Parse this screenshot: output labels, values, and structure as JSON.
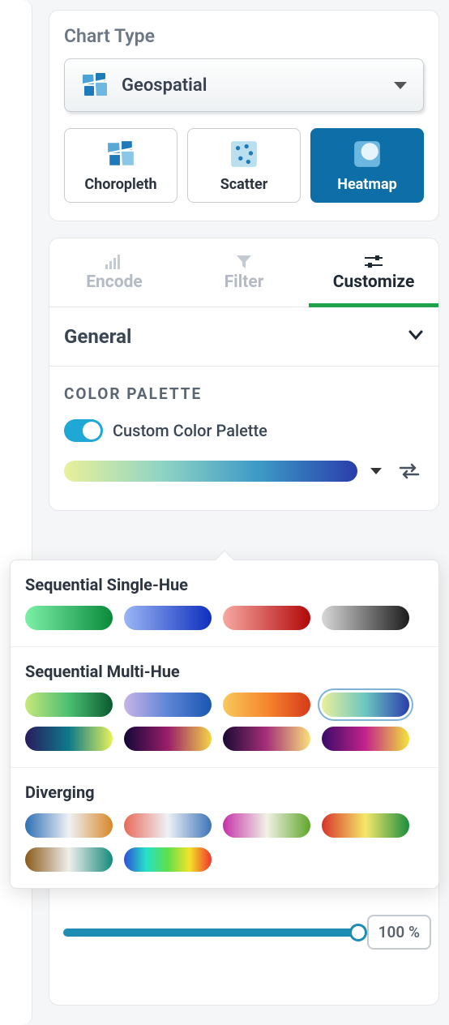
{
  "chart_type": {
    "title": "Chart Type",
    "selected": "Geospatial",
    "subtypes": [
      "Choropleth",
      "Scatter",
      "Heatmap"
    ],
    "active_subtype": "Heatmap"
  },
  "tabs": {
    "items": [
      "Encode",
      "Filter",
      "Customize"
    ],
    "active": "Customize"
  },
  "general": {
    "title": "General",
    "color_palette_label": "COLOR PALETTE",
    "custom_toggle_label": "Custom Color Palette",
    "custom_toggle_on": true,
    "opacity_value": "100 %"
  },
  "palette_popover": {
    "sections": [
      {
        "title": "Sequential Single-Hue",
        "rows": [
          [
            {
              "gradient": "linear-gradient(90deg,#7cf0a7,#0a8a3c)"
            },
            {
              "gradient": "linear-gradient(90deg,#9bb6f5,#0d2fbd)"
            },
            {
              "gradient": "linear-gradient(90deg,#f7a9a2,#b10808)"
            },
            {
              "gradient": "linear-gradient(90deg,#d8d8d8,#1c1c1c)"
            }
          ]
        ]
      },
      {
        "title": "Sequential Multi-Hue",
        "rows": [
          [
            {
              "gradient": "linear-gradient(90deg,#c7e87a,#4bbf72,#0a5a2e)"
            },
            {
              "gradient": "linear-gradient(90deg,#c8b4e8,#5d85d6,#1a56b0)"
            },
            {
              "gradient": "linear-gradient(90deg,#f7c95c,#f6872e,#d63a1a)"
            },
            {
              "gradient": "linear-gradient(90deg,#e9f09a,#6bc6c0,#2a3dab)",
              "selected": true
            }
          ],
          [
            {
              "gradient": "linear-gradient(90deg,#2a1a5e,#0d7a8a,#e7f25a)"
            },
            {
              "gradient": "linear-gradient(90deg,#120638,#9a1e6a,#f5d547)"
            },
            {
              "gradient": "linear-gradient(90deg,#1a0933,#a6307a,#f9e07a)"
            },
            {
              "gradient": "linear-gradient(90deg,#3a0a6a,#c4238a,#f2e53a)"
            }
          ]
        ]
      },
      {
        "title": "Diverging",
        "rows": [
          [
            {
              "gradient": "linear-gradient(90deg,#2d6fb3,#eef2f5,#d8872a)"
            },
            {
              "gradient": "linear-gradient(90deg,#e86a5a,#eef2f5,#3d74b8)"
            },
            {
              "gradient": "linear-gradient(90deg,#c431a8,#f2f2e6,#5fa62a)"
            },
            {
              "gradient": "linear-gradient(90deg,#d8342a,#f5e96a,#1a8c3e)"
            }
          ],
          [
            {
              "gradient": "linear-gradient(90deg,#8a5a1a,#f0efec,#148a7a)"
            },
            {
              "gradient": "linear-gradient(90deg,#2c4fd8,#26e0c8,#5fe04a,#f5e22a,#f2332a)"
            }
          ]
        ]
      }
    ]
  }
}
